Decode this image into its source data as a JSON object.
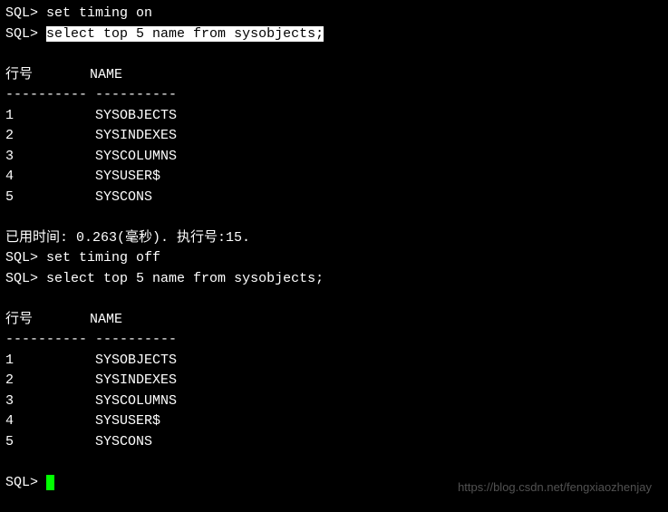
{
  "prompt": "SQL>",
  "cmd1": "set timing on",
  "cmd2": "select top 5 name from sysobjects;",
  "header_rownum": "行号",
  "header_name": "NAME",
  "divider_rownum": "----------",
  "divider_name": "----------",
  "rows1": [
    {
      "n": "1",
      "name": "SYSOBJECTS"
    },
    {
      "n": "2",
      "name": "SYSINDEXES"
    },
    {
      "n": "3",
      "name": "SYSCOLUMNS"
    },
    {
      "n": "4",
      "name": "SYSUSER$"
    },
    {
      "n": "5",
      "name": "SYSCONS"
    }
  ],
  "timing_line": "已用时间: 0.263(毫秒). 执行号:15.",
  "cmd3": "set timing off",
  "cmd4": "select top 5 name from sysobjects;",
  "rows2": [
    {
      "n": "1",
      "name": "SYSOBJECTS"
    },
    {
      "n": "2",
      "name": "SYSINDEXES"
    },
    {
      "n": "3",
      "name": "SYSCOLUMNS"
    },
    {
      "n": "4",
      "name": "SYSUSER$"
    },
    {
      "n": "5",
      "name": "SYSCONS"
    }
  ],
  "watermark": "https://blog.csdn.net/fengxiaozhenjay"
}
